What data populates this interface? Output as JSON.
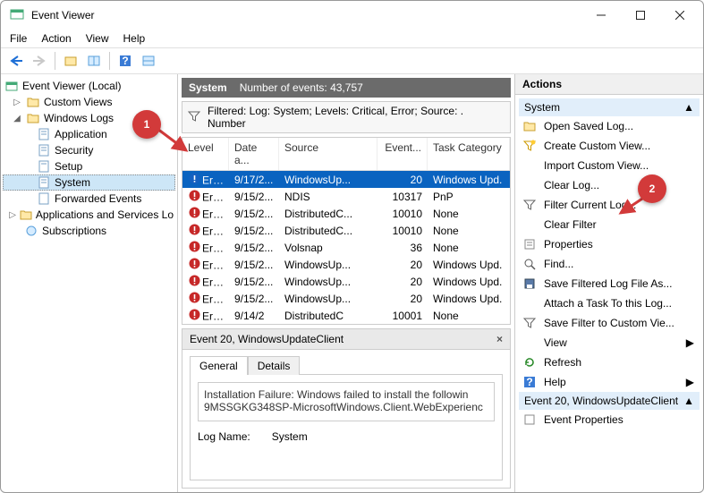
{
  "window": {
    "title": "Event Viewer"
  },
  "menu": {
    "file": "File",
    "action": "Action",
    "view": "View",
    "help": "Help"
  },
  "tree": {
    "root": "Event Viewer (Local)",
    "custom": "Custom Views",
    "winlogs": "Windows Logs",
    "app": "Application",
    "security": "Security",
    "setup": "Setup",
    "system": "System",
    "forwarded": "Forwarded Events",
    "appsvc": "Applications and Services Lo",
    "subs": "Subscriptions"
  },
  "center": {
    "header_title": "System",
    "count_label": "Number of events: 43,757",
    "filter_text": "Filtered: Log: System; Levels: Critical, Error; Source: . Number",
    "cols": {
      "level": "Level",
      "date": "Date a...",
      "source": "Source",
      "event": "Event...",
      "task": "Task Category"
    },
    "rows": [
      {
        "level": "Error",
        "date": "9/17/2...",
        "source": "WindowsUp...",
        "event": "20",
        "task": "Windows Upd."
      },
      {
        "level": "Error",
        "date": "9/15/2...",
        "source": "NDIS",
        "event": "10317",
        "task": "PnP"
      },
      {
        "level": "Error",
        "date": "9/15/2...",
        "source": "DistributedC...",
        "event": "10010",
        "task": "None"
      },
      {
        "level": "Error",
        "date": "9/15/2...",
        "source": "DistributedC...",
        "event": "10010",
        "task": "None"
      },
      {
        "level": "Error",
        "date": "9/15/2...",
        "source": "Volsnap",
        "event": "36",
        "task": "None"
      },
      {
        "level": "Error",
        "date": "9/15/2...",
        "source": "WindowsUp...",
        "event": "20",
        "task": "Windows Upd."
      },
      {
        "level": "Error",
        "date": "9/15/2...",
        "source": "WindowsUp...",
        "event": "20",
        "task": "Windows Upd."
      },
      {
        "level": "Error",
        "date": "9/15/2...",
        "source": "WindowsUp...",
        "event": "20",
        "task": "Windows Upd."
      },
      {
        "level": "Error",
        "date": "9/14/2",
        "source": "DistributedC",
        "event": "10001",
        "task": "None"
      }
    ]
  },
  "detail": {
    "title": "Event 20, WindowsUpdateClient",
    "tab_general": "General",
    "tab_details": "Details",
    "msg_l1": "Installation Failure: Windows failed to install the followin",
    "msg_l2": "9MSSGKG348SP-MicrosoftWindows.Client.WebExperienc",
    "logname_label": "Log Name:",
    "logname_value": "System"
  },
  "actions": {
    "hdr": "Actions",
    "sec1": "System",
    "open": "Open Saved Log...",
    "createcv": "Create Custom View...",
    "importcv": "Import Custom View...",
    "clearlog": "Clear Log...",
    "filter": "Filter Current Log...",
    "clearfilter": "Clear Filter",
    "props": "Properties",
    "find": "Find...",
    "saveas": "Save Filtered Log File As...",
    "attach": "Attach a Task To this Log...",
    "savefilter": "Save Filter to Custom Vie...",
    "view": "View",
    "refresh": "Refresh",
    "help": "Help",
    "sec2": "Event 20, WindowsUpdateClient",
    "evprops": "Event Properties"
  },
  "callouts": {
    "c1": "1",
    "c2": "2"
  }
}
